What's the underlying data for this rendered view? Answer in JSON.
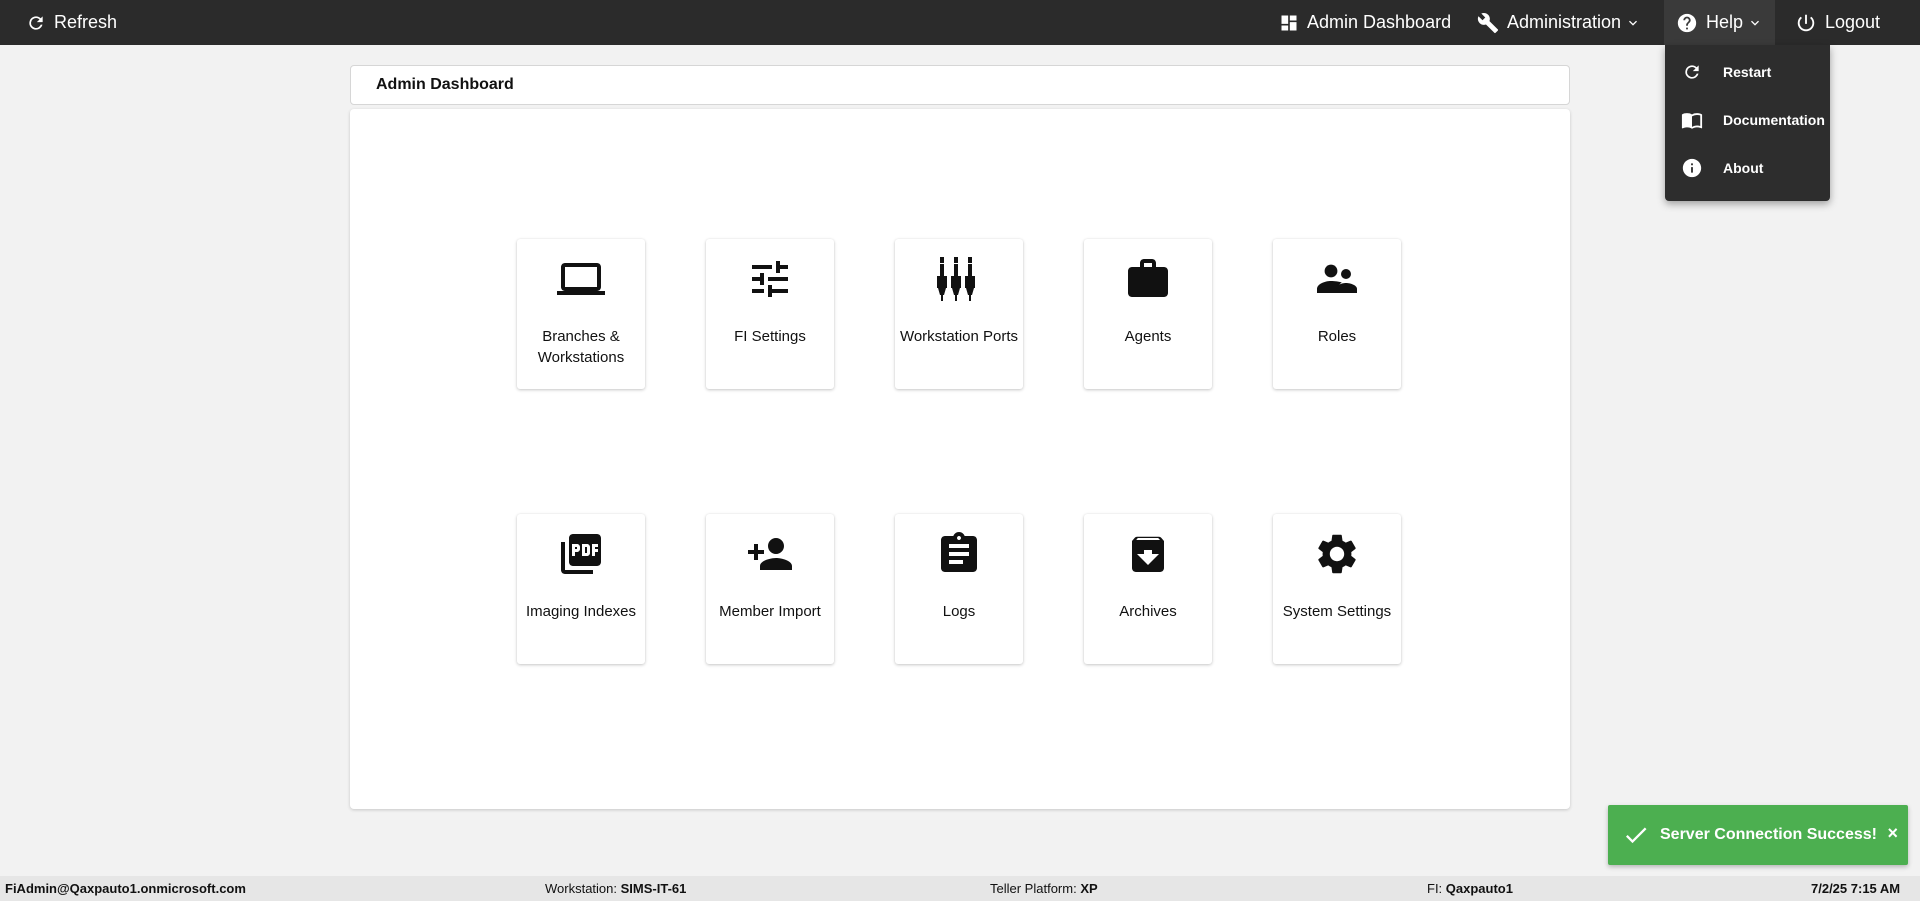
{
  "topbar": {
    "refresh_label": "Refresh",
    "admin_dashboard_label": "Admin Dashboard",
    "administration_label": "Administration",
    "help_label": "Help",
    "logout_label": "Logout"
  },
  "help_menu": {
    "items": [
      {
        "label": "Restart",
        "icon": "restart-icon"
      },
      {
        "label": "Documentation",
        "icon": "book-icon"
      },
      {
        "label": "About",
        "icon": "info-icon"
      }
    ]
  },
  "page": {
    "title": "Admin Dashboard"
  },
  "tiles": [
    {
      "label": "Branches & Workstations",
      "icon": "laptop-icon"
    },
    {
      "label": "FI Settings",
      "icon": "sliders-icon"
    },
    {
      "label": "Workstation Ports",
      "icon": "ports-icon"
    },
    {
      "label": "Agents",
      "icon": "briefcase-icon"
    },
    {
      "label": "Roles",
      "icon": "people-icon"
    },
    {
      "label": "Imaging Indexes",
      "icon": "pdf-icon"
    },
    {
      "label": "Member Import",
      "icon": "person-add-icon"
    },
    {
      "label": "Logs",
      "icon": "clipboard-icon"
    },
    {
      "label": "Archives",
      "icon": "archive-icon"
    },
    {
      "label": "System Settings",
      "icon": "gear-icon"
    }
  ],
  "toast": {
    "message": "Server Connection Success!",
    "close": "×",
    "color": "#4caf50"
  },
  "statusbar": {
    "user": "FiAdmin@Qaxpauto1.onmicrosoft.com",
    "workstation_label": "Workstation:",
    "workstation_value": "SIMS-IT-61",
    "platform_label": "Teller Platform:",
    "platform_value": "XP",
    "fi_label": "FI:",
    "fi_value": "Qaxpauto1",
    "datetime": "7/2/25 7:15 AM"
  },
  "colors": {
    "topbar": "#2b2b2b",
    "background": "#f2f2f2",
    "toast": "#4caf50"
  }
}
